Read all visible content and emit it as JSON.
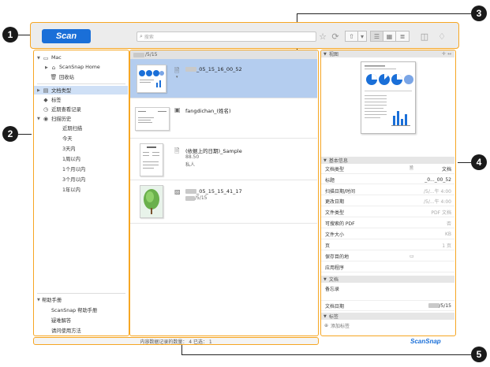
{
  "callouts": [
    "1",
    "2",
    "3",
    "4",
    "5"
  ],
  "toolbar": {
    "scan_label": "Scan",
    "search_placeholder": "搜索",
    "icons": [
      "star-icon",
      "refresh-icon",
      "share-icon",
      "list-view-icon",
      "grid-view-icon",
      "detail-view-icon",
      "panel-icon",
      "bell-icon"
    ]
  },
  "sidebar": {
    "items": [
      {
        "label": "Mac",
        "icon": "computer-icon"
      },
      {
        "label": "ScanSnap Home",
        "icon": "home-icon"
      },
      {
        "label": "回收站",
        "icon": "trash-icon"
      },
      {
        "label": "文档类型",
        "icon": "doc-type-icon"
      },
      {
        "label": "标签",
        "icon": "tag-icon"
      },
      {
        "label": "近期查看记录",
        "icon": "recent-icon"
      },
      {
        "label": "扫描历史",
        "icon": "history-icon"
      },
      {
        "label": "近期扫描"
      },
      {
        "label": "今天"
      },
      {
        "label": "3天内"
      },
      {
        "label": "1周以内"
      },
      {
        "label": "1个月以内"
      },
      {
        "label": "3个月以内"
      },
      {
        "label": "1年以内"
      }
    ],
    "help": {
      "title": "帮助手册",
      "items": [
        "ScanSnap 帮助手册",
        "疑难解答",
        "请问使用方法"
      ]
    }
  },
  "list": {
    "header_date": "/5/15",
    "rows": [
      {
        "name": "_05_15_16_00_52",
        "sub": ""
      },
      {
        "name": "fangdichan_(姓名)",
        "sub": ""
      },
      {
        "name": "(依据上的日期)_Sample",
        "sub1": "88.50",
        "sub2": "私人"
      },
      {
        "name": "_05_15_15_41_17",
        "sub1": "/5/15"
      }
    ]
  },
  "details": {
    "view_label": "视图",
    "basic_label": "基本信息",
    "props": [
      {
        "k": "文档类型",
        "v": "文档"
      },
      {
        "k": "标题",
        "v": "_0..._00_52"
      },
      {
        "k": "扫描日期/时间",
        "v": "/5/...午 4:00"
      },
      {
        "k": "更改日期",
        "v": "/5/...午 4:00"
      },
      {
        "k": "文件类型",
        "v": "PDF 文档"
      },
      {
        "k": "可搜索的 PDF",
        "v": "否"
      },
      {
        "k": "文件大小",
        "v": "KB"
      },
      {
        "k": "页",
        "v": "1 页"
      },
      {
        "k": "保存目的地",
        "v": ""
      },
      {
        "k": "应用程序",
        "v": ""
      }
    ],
    "doc_label": "文档",
    "memo_label": "备忘录",
    "doc_date_label": "文档日期",
    "doc_date_value": "/5/15",
    "tags_label": "标签",
    "add_tag_label": "添加标签"
  },
  "status": {
    "text": "内容数据记录的数量： 4  已选： 1",
    "brand": "ScanSnap"
  }
}
